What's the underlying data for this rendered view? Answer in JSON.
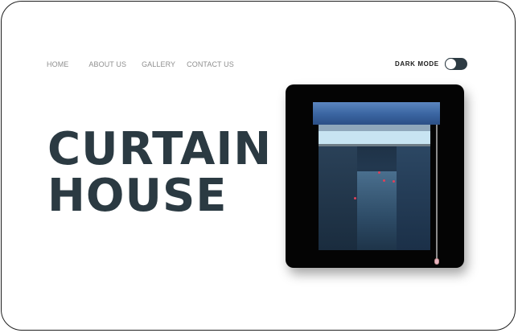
{
  "nav": {
    "items": [
      {
        "label": "HOME"
      },
      {
        "label": "ABOUT US"
      },
      {
        "label": "GALLERY"
      },
      {
        "label": "CONTACT US"
      }
    ]
  },
  "dark_mode": {
    "label": "DARK MODE",
    "enabled": false
  },
  "hero": {
    "line1": "CURTAIN",
    "line2": "HOUSE"
  },
  "window": {
    "blind_level": 0.1
  },
  "colors": {
    "title": "#2b3a42",
    "toggle": "#2d3b43",
    "blind": "#3c67a3",
    "card": "#040404"
  }
}
